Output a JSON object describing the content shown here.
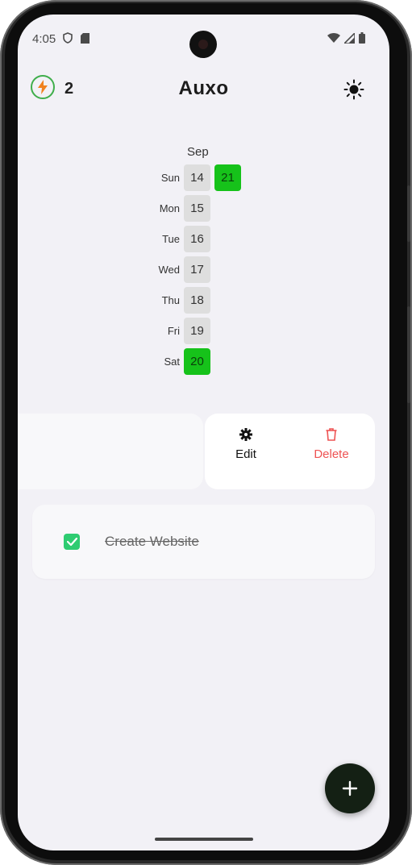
{
  "status_bar": {
    "time": "4:05",
    "icons_left": [
      "shield-icon",
      "sd-card-icon"
    ],
    "icons_right": [
      "wifi-icon",
      "signal-icon",
      "battery-icon"
    ]
  },
  "header": {
    "streak_icon": "bolt-icon",
    "streak_count": "2",
    "title": "Auxo",
    "theme_icon": "sun-icon"
  },
  "calendar": {
    "month": "Sep",
    "rows": [
      {
        "day": "Sun",
        "dates": [
          {
            "label": "14",
            "done": false
          },
          {
            "label": "21",
            "done": true
          }
        ]
      },
      {
        "day": "Mon",
        "dates": [
          {
            "label": "15",
            "done": false
          }
        ]
      },
      {
        "day": "Tue",
        "dates": [
          {
            "label": "16",
            "done": false
          }
        ]
      },
      {
        "day": "Wed",
        "dates": [
          {
            "label": "17",
            "done": false
          }
        ]
      },
      {
        "day": "Thu",
        "dates": [
          {
            "label": "18",
            "done": false
          }
        ]
      },
      {
        "day": "Fri",
        "dates": [
          {
            "label": "19",
            "done": false
          }
        ]
      },
      {
        "day": "Sat",
        "dates": [
          {
            "label": "20",
            "done": true
          }
        ]
      }
    ],
    "done_color": "#16c21a",
    "empty_color": "#dedede"
  },
  "swipe_actions": {
    "edit_label": "Edit",
    "edit_icon": "gear-icon",
    "delete_label": "Delete",
    "delete_icon": "trash-icon",
    "delete_color": "#ee5353"
  },
  "tasks": [
    {
      "title": "Create Website",
      "completed": true
    }
  ],
  "fab": {
    "icon": "plus-icon"
  }
}
